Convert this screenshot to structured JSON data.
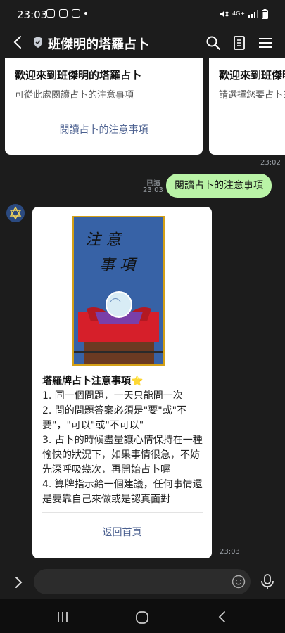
{
  "status_bar": {
    "time": "23:03",
    "network": "4G+"
  },
  "header": {
    "title": "班傑明的塔羅占卜"
  },
  "chat": {
    "card1": {
      "title": "歡迎來到班傑明的塔羅占卜",
      "subtitle": "可從此處閱讀占卜的注意事項",
      "link": "閱讀占卜的注意事項"
    },
    "card2": {
      "title": "歡迎來到班傑明的塔羅占卜",
      "subtitle": "請選擇您要占卜的"
    },
    "ts1": "23:02",
    "sent": {
      "read": "已讀",
      "time": "23:03",
      "text": "閱讀占卜的注意事項"
    },
    "notice": {
      "image_text_line1": "注 意",
      "image_text_line2": "事 項",
      "title": "塔羅牌占卜注意事項⭐",
      "body": "1. 同一個問題，一天只能問一次\n2. 問的問題答案必須是\"要\"或\"不要\"，\"可以\"或\"不可以\"\n3. 占卜的時候盡量讓心情保持在一種愉快的狀況下，如果事情很急，不妨先深呼吸幾次，再開始占卜喔\n4. 算牌指示給一個建議，任何事情還是要靠自己來做或是認真面對",
      "button": "返回首頁",
      "time": "23:03"
    }
  },
  "icons": {
    "back": "back-arrow-icon",
    "shield": "shield-icon",
    "search": "search-icon",
    "notes": "notes-icon",
    "menu": "menu-icon",
    "expand": "chevron-right-icon",
    "emoji": "emoji-icon",
    "mic": "microphone-icon"
  }
}
